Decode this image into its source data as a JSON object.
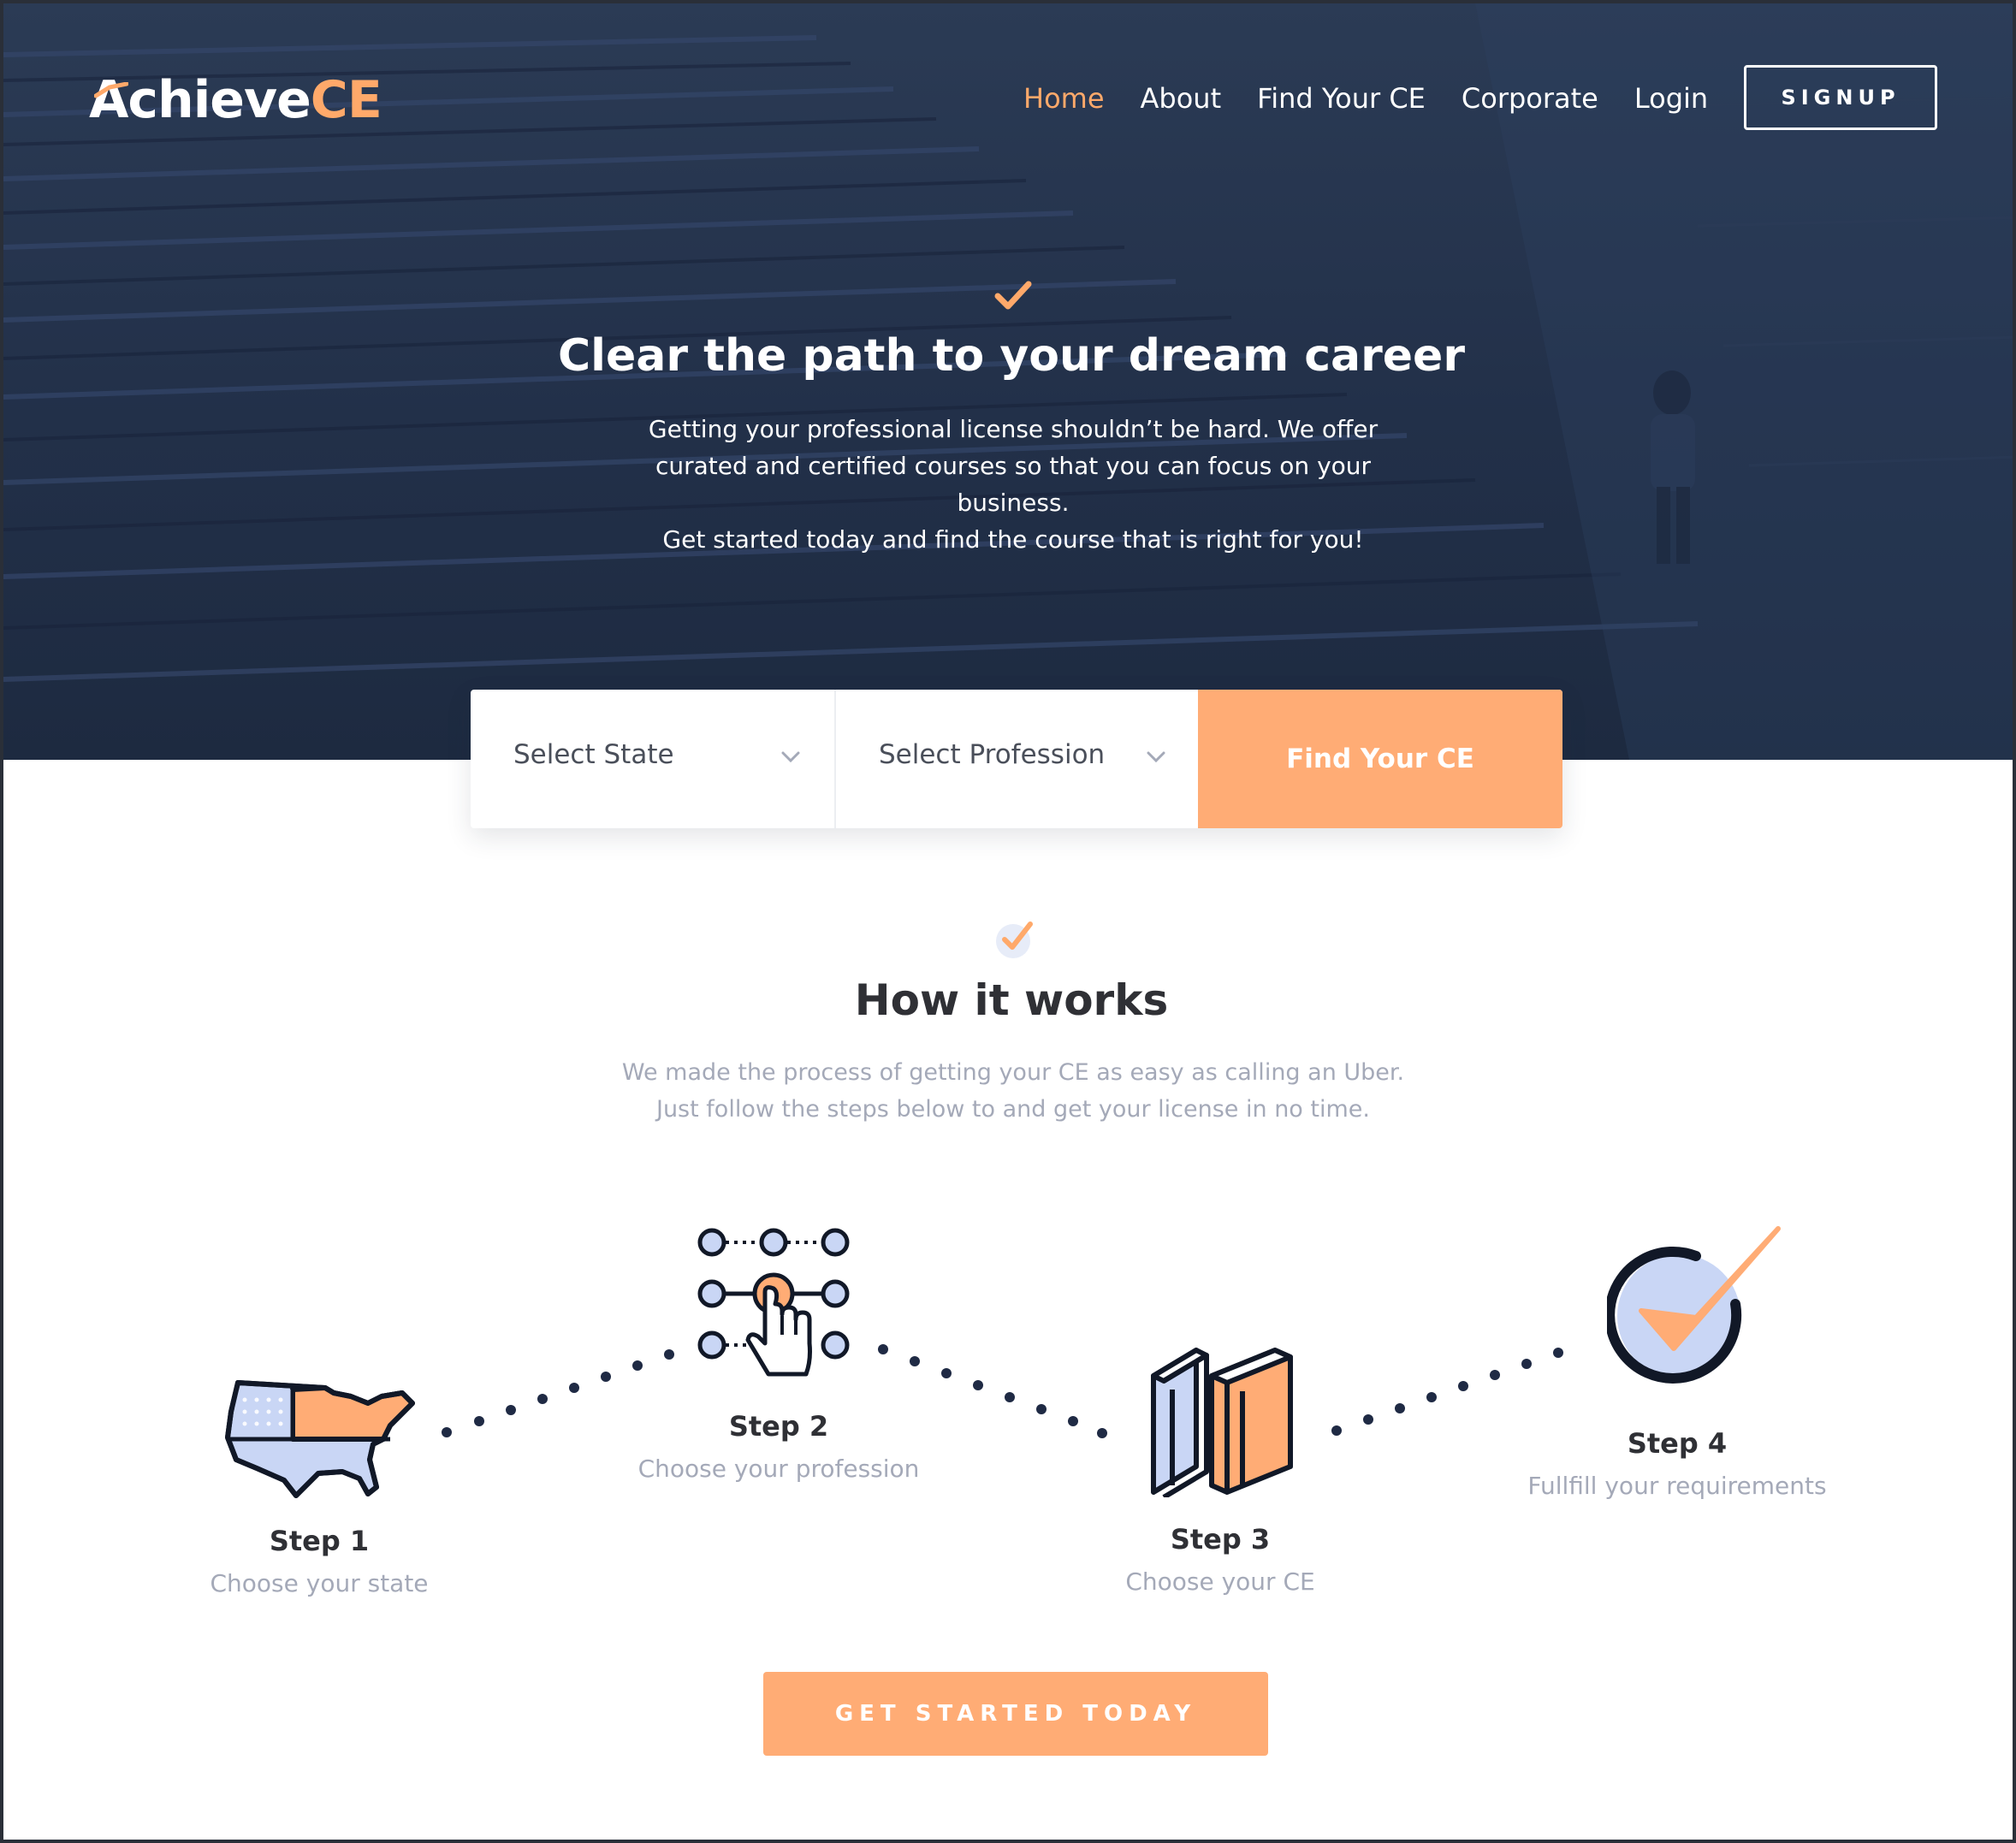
{
  "brand": {
    "name_part1": "Achieve",
    "name_part2": "CE",
    "accent": "#ffa96a"
  },
  "nav": {
    "items": [
      {
        "label": "Home",
        "active": true
      },
      {
        "label": "About",
        "active": false
      },
      {
        "label": "Find Your CE",
        "active": false
      },
      {
        "label": "Corporate",
        "active": false
      },
      {
        "label": "Login",
        "active": false
      }
    ],
    "signup_label": "SIGNUP"
  },
  "hero": {
    "icon": "check-icon",
    "title": "Clear the path to your dream career",
    "description_lines": [
      "Getting your professional license shouldn’t be hard. We offer",
      "curated and certified courses so that you can focus on your business.",
      "Get started today and find the course that is right for you!"
    ]
  },
  "search": {
    "state_placeholder": "Select State",
    "profession_placeholder": "Select Profession",
    "button_label": "Find Your CE"
  },
  "how_it_works": {
    "icon": "check-badge-icon",
    "title": "How it works",
    "description_lines": [
      "We made the process of getting your CE as easy as calling an Uber.",
      "Just follow the steps below to and get your license in no time."
    ],
    "steps": [
      {
        "title": "Step 1",
        "subtitle": "Choose your state",
        "icon": "us-map-icon"
      },
      {
        "title": "Step 2",
        "subtitle": "Choose your profession",
        "icon": "selection-grid-icon"
      },
      {
        "title": "Step 3",
        "subtitle": "Choose your CE",
        "icon": "books-icon"
      },
      {
        "title": "Step 4",
        "subtitle": "Fullfill your requirements",
        "icon": "check-circle-icon"
      }
    ],
    "cta_label": "GET STARTED TODAY"
  },
  "colors": {
    "hero_bg": "#223049",
    "accent": "#ffac75",
    "navy": "#1f2a44",
    "light_blue": "#c9d6f5",
    "muted_text": "#a4a9b8"
  }
}
